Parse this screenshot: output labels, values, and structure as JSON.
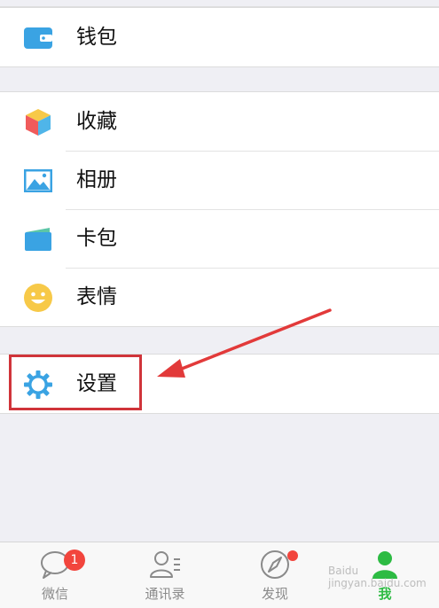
{
  "menu": {
    "wallet": "钱包",
    "favorites": "收藏",
    "album": "相册",
    "cards": "卡包",
    "stickers": "表情",
    "settings": "设置"
  },
  "tabs": {
    "chats": "微信",
    "contacts": "通讯录",
    "discover": "发现",
    "me": "我"
  },
  "badges": {
    "chats_unread": "1"
  },
  "watermark": "Baidu jingyan.baidu.com",
  "colors": {
    "accent": "#2dbb43",
    "badge": "#f2453d",
    "highlight": "#d0343a",
    "icon_blue": "#3aa3e3"
  }
}
